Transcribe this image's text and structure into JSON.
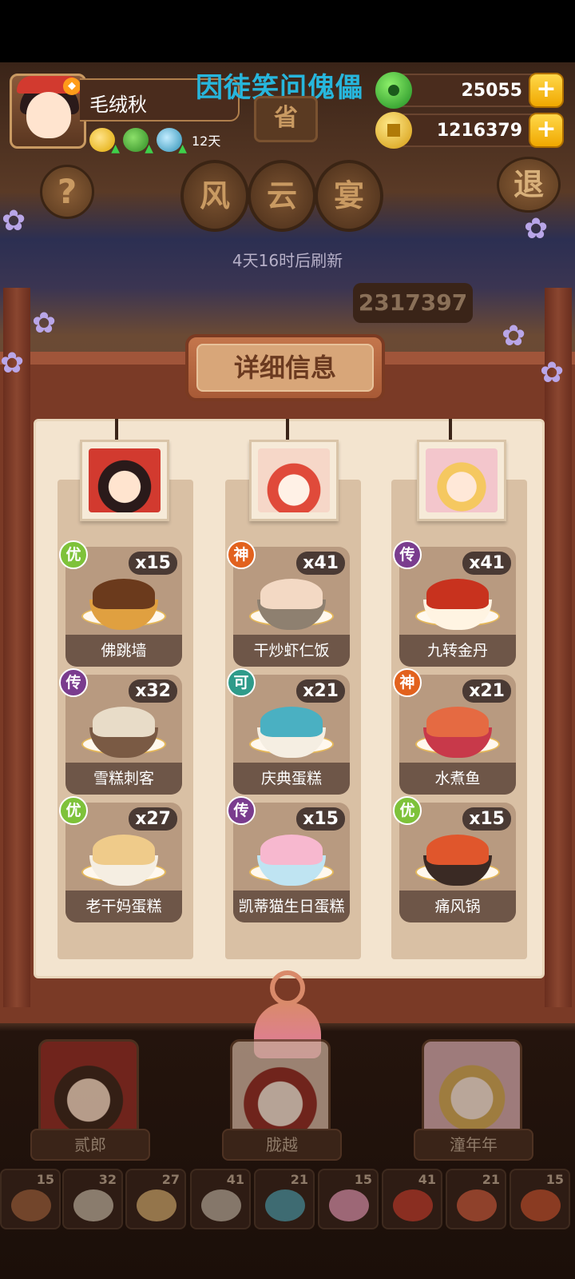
{
  "overlay_title": "因徒笑问傀儡",
  "player": {
    "name": "毛绒秋",
    "level_icon": "flame-icon",
    "buff_days": "12天"
  },
  "resources": {
    "jade": "25055",
    "coins": "1216379"
  },
  "signage": {
    "province": "省",
    "chars": [
      "风",
      "云",
      "宴"
    ],
    "refresh_text": "4天16时后刷新",
    "score": "2317397"
  },
  "buttons": {
    "help": "?",
    "exit": "退"
  },
  "panel": {
    "title": "详细信息"
  },
  "columns": [
    {
      "character": "贰郎",
      "dishes": [
        {
          "name": "佛跳墙",
          "count": "x15",
          "rarity": "优",
          "rarity_key": "you",
          "food": "#6b3a1c",
          "bowl": "#e0a040"
        },
        {
          "name": "雪糕刺客",
          "count": "x32",
          "rarity": "传",
          "rarity_key": "chuan",
          "food": "#e8dcc8",
          "bowl": "#7a5a44"
        },
        {
          "name": "老干妈蛋糕",
          "count": "x27",
          "rarity": "优",
          "rarity_key": "you",
          "food": "#efcb8a",
          "bowl": "#f5eee2"
        }
      ]
    },
    {
      "character": "胧越",
      "dishes": [
        {
          "name": "干炒虾仁饭",
          "count": "x41",
          "rarity": "神",
          "rarity_key": "shen",
          "food": "#f3d9c4",
          "bowl": "#8e8070"
        },
        {
          "name": "庆典蛋糕",
          "count": "x21",
          "rarity": "可",
          "rarity_key": "ke",
          "food": "#4ab0c2",
          "bowl": "#f5eee2"
        },
        {
          "name": "凯蒂猫生日蛋糕",
          "count": "x15",
          "rarity": "传",
          "rarity_key": "chuan",
          "food": "#f7b8cf",
          "bowl": "#bfe4f2"
        }
      ]
    },
    {
      "character": "潼年年",
      "dishes": [
        {
          "name": "九转金丹",
          "count": "x41",
          "rarity": "传",
          "rarity_key": "chuan",
          "food": "#c8321e",
          "bowl": "#fff4e2"
        },
        {
          "name": "水煮鱼",
          "count": "x21",
          "rarity": "神",
          "rarity_key": "shen",
          "food": "#e56a42",
          "bowl": "#c8394a"
        },
        {
          "name": "痛风锅",
          "count": "x15",
          "rarity": "优",
          "rarity_key": "you",
          "food": "#e0562c",
          "bowl": "#3a2a24"
        }
      ]
    }
  ],
  "dish_strip": [
    {
      "count": "15",
      "color": "#a0603a"
    },
    {
      "count": "32",
      "color": "#c8bca8"
    },
    {
      "count": "27",
      "color": "#d8b070"
    },
    {
      "count": "41",
      "color": "#c0b4a4"
    },
    {
      "count": "21",
      "color": "#4aa0b0"
    },
    {
      "count": "15",
      "color": "#e89ab8"
    },
    {
      "count": "41",
      "color": "#c83a2a"
    },
    {
      "count": "21",
      "color": "#d05a3a"
    },
    {
      "count": "15",
      "color": "#c8502c"
    }
  ]
}
